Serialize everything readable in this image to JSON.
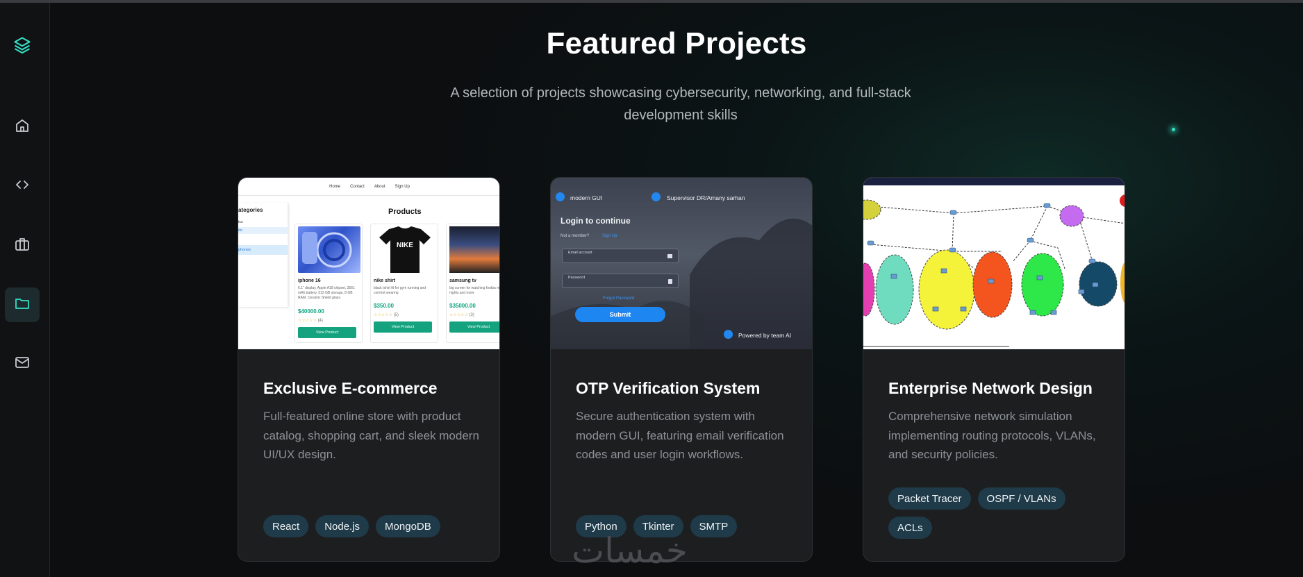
{
  "page": {
    "title": "Featured Projects",
    "subtitle": "A selection of projects showcasing cybersecurity, networking, and full-stack development skills"
  },
  "sidebar": {
    "logo_icon": "layers-icon",
    "items": [
      {
        "name": "home",
        "icon": "home-icon",
        "active": false
      },
      {
        "name": "code",
        "icon": "code-icon",
        "active": false
      },
      {
        "name": "briefcase",
        "icon": "briefcase-icon",
        "active": false
      },
      {
        "name": "projects",
        "icon": "folder-icon",
        "active": true
      },
      {
        "name": "contact",
        "icon": "mail-icon",
        "active": false
      }
    ]
  },
  "colors": {
    "accent": "#35e0c5",
    "card_bg": "#1d1e20",
    "tag_bg": "#1f3a48"
  },
  "projects": [
    {
      "title": "Exclusive E-commerce",
      "description": "Full-featured online store with product catalog, shopping cart, and sleek modern UI/UX design.",
      "tags": [
        "React",
        "Node.js",
        "MongoDB"
      ],
      "preview": {
        "nav": [
          "Home",
          "Contact",
          "About",
          "Sign Up"
        ],
        "sidebar_heading": "ategories",
        "sidebar_items": [
          "ics",
          "ds",
          "phones"
        ],
        "heading": "Products",
        "products": [
          {
            "name": "iphone 16",
            "desc": "6.1\" display, Apple A18 chipset, 3561 mAh battery, 512 GB storage, 8 GB RAM, Ceramic Shield glass.",
            "price": "$40000.00",
            "reviews": "(4)",
            "button": "View Product"
          },
          {
            "name": "nike shirt",
            "desc": "black tshirt fit for gym running and comfort wearing",
            "price": "$350.00",
            "reviews": "(5)",
            "button": "View Product"
          },
          {
            "name": "samsung tv",
            "desc": "big screen for watching footba movie nights and more",
            "price": "$35000.00",
            "reviews": "(3)",
            "button": "View Product"
          }
        ]
      }
    },
    {
      "title": "OTP Verification System",
      "description": "Secure authentication system with modern GUI, featuring email verification codes and user login workflows.",
      "tags": [
        "Python",
        "Tkinter",
        "SMTP"
      ],
      "preview": {
        "label_left": "modern GUI",
        "label_right": "Supervisor DR/Amany sarhan",
        "heading": "Login to continue",
        "member_text": "Not a member?",
        "signup": "Sign Up",
        "email_label": "Email account",
        "password_label": "Password",
        "forgot": "Forgot Password",
        "submit": "Submit",
        "footer": "Powered by team AI"
      }
    },
    {
      "title": "Enterprise Network Design",
      "description": "Comprehensive network simulation implementing routing protocols, VLANs, and security policies.",
      "tags": [
        "Packet Tracer",
        "OSPF / VLANs",
        "ACLs"
      ]
    }
  ],
  "watermark": "خمسات"
}
